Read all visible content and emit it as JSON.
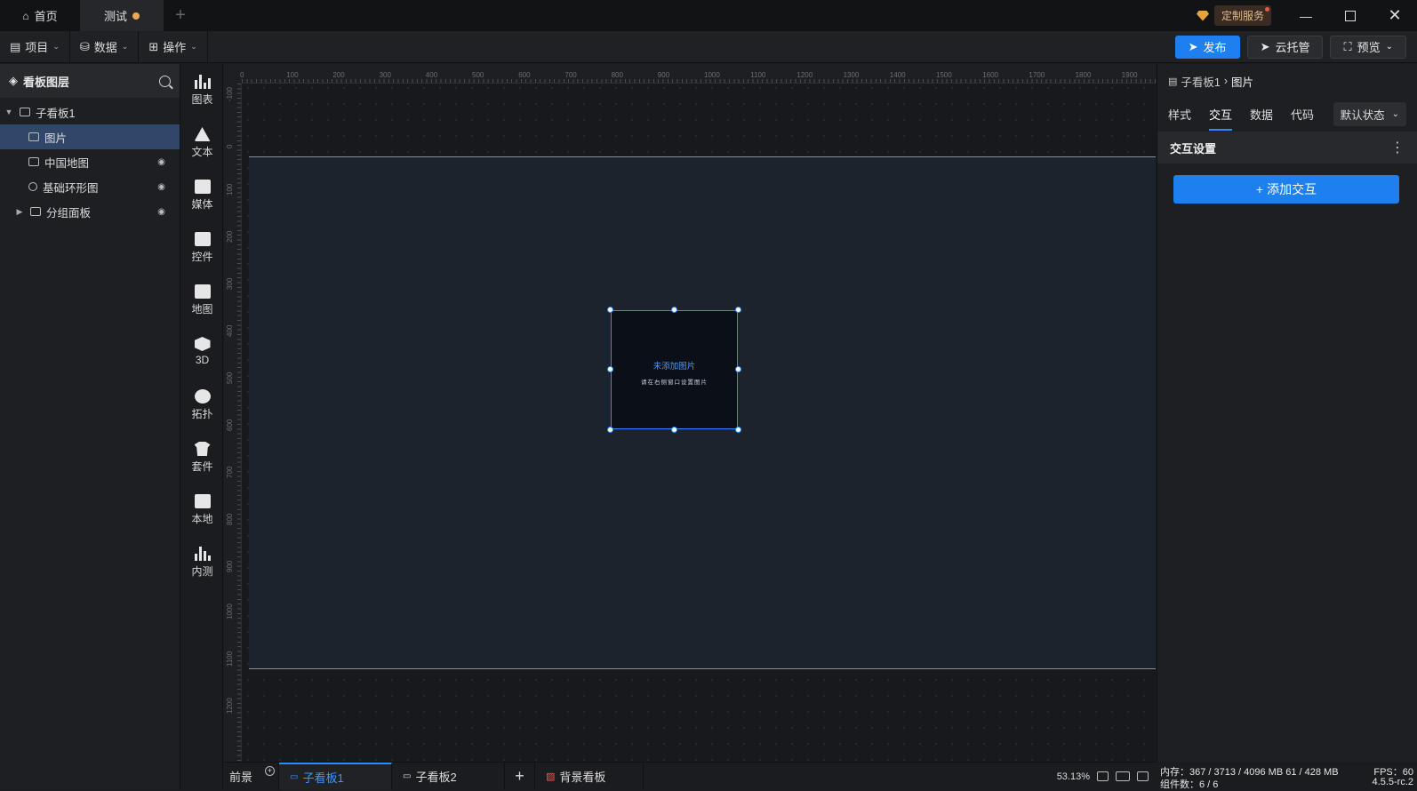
{
  "titlebar": {
    "tabs": [
      {
        "label": "首页"
      },
      {
        "label": "测试"
      }
    ],
    "custom_service": "定制服务"
  },
  "menubar": {
    "menus": [
      {
        "label": "项目"
      },
      {
        "label": "数据"
      },
      {
        "label": "操作"
      }
    ],
    "publish": "发布",
    "cloud": "云托管",
    "preview": "预览"
  },
  "layers": {
    "title": "看板图层",
    "items": [
      {
        "label": "子看板1"
      },
      {
        "label": "图片"
      },
      {
        "label": "中国地图"
      },
      {
        "label": "基础环形图"
      },
      {
        "label": "分组面板"
      }
    ]
  },
  "components": [
    {
      "label": "图表"
    },
    {
      "label": "文本"
    },
    {
      "label": "媒体"
    },
    {
      "label": "控件"
    },
    {
      "label": "地图"
    },
    {
      "label": "3D"
    },
    {
      "label": "拓扑"
    },
    {
      "label": "套件"
    },
    {
      "label": "本地"
    },
    {
      "label": "内测"
    }
  ],
  "ruler": {
    "h": [
      "0",
      "100",
      "200",
      "300",
      "400",
      "500",
      "600",
      "700",
      "800",
      "900",
      "1000",
      "1100",
      "1200",
      "1300",
      "1400",
      "1500",
      "1600",
      "1700",
      "1800",
      "1900"
    ],
    "v": [
      "-100",
      "0",
      "100",
      "200",
      "300",
      "400",
      "500",
      "600",
      "700",
      "800",
      "900",
      "1000",
      "1100",
      "1200"
    ]
  },
  "image_element": {
    "title": "未添加图片",
    "hint": "请在右侧窗口设置图片"
  },
  "bottom": {
    "foreground": "前景",
    "tabs": [
      {
        "label": "子看板1"
      },
      {
        "label": "子看板2"
      }
    ],
    "background": "背景看板",
    "zoom": "53.13%"
  },
  "rpanel": {
    "crumb_parent": "子看板1",
    "crumb_current": "图片",
    "tabs": [
      {
        "label": "样式"
      },
      {
        "label": "交互"
      },
      {
        "label": "数据"
      },
      {
        "label": "代码"
      }
    ],
    "state": "默认状态",
    "section": "交互设置",
    "add_button": "添加交互"
  },
  "status": {
    "memory": "内存：367 / 3713 / 4096 MB  61 / 428 MB",
    "fps": "FPS：60",
    "components": "组件数：6 / 6",
    "version": "4.5.5-rc.2"
  }
}
